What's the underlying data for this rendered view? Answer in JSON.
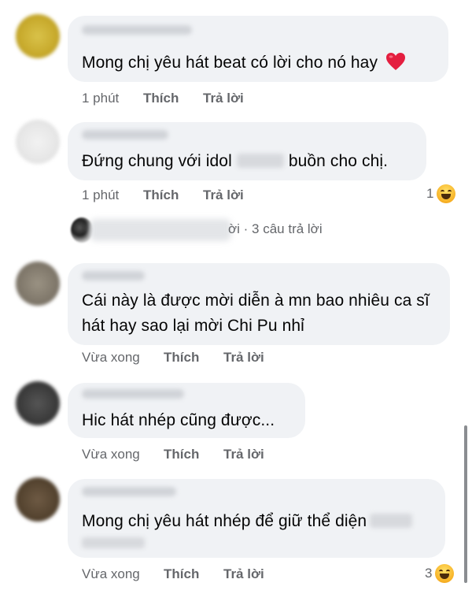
{
  "comments": [
    {
      "text": "Mong chị yêu hát beat có lời cho nó hay",
      "time": "1 phút",
      "like": "Thích",
      "reply": "Trả lời"
    },
    {
      "text_before": "Đứng chung với idol",
      "text_after": "buồn cho chị.",
      "time": "1 phút",
      "like": "Thích",
      "reply": "Trả lời",
      "reaction_count": "1"
    },
    {
      "text": "Cái này là được mời diễn à mn bao nhiêu ca sĩ hát hay sao lại mời Chi Pu nhỉ",
      "time": "Vừa xong",
      "like": "Thích",
      "reply": "Trả lời"
    },
    {
      "text": "Hic hát nhép cũng được...",
      "time": "Vừa xong",
      "like": "Thích",
      "reply": "Trả lời"
    },
    {
      "text": "Mong chị yêu hát nhép để giữ thể diện",
      "time": "Vừa xong",
      "like": "Thích",
      "reply": "Trả lời",
      "reaction_count": "3"
    }
  ],
  "replies_summary": "ời · 3 câu trả lời",
  "colors": {
    "bubble": "#f0f2f5",
    "meta_text": "#65676b",
    "heart": "#e41e3f"
  },
  "icons": {
    "heart": "heart-emoji-icon",
    "reaction": "haha-reaction-icon"
  }
}
